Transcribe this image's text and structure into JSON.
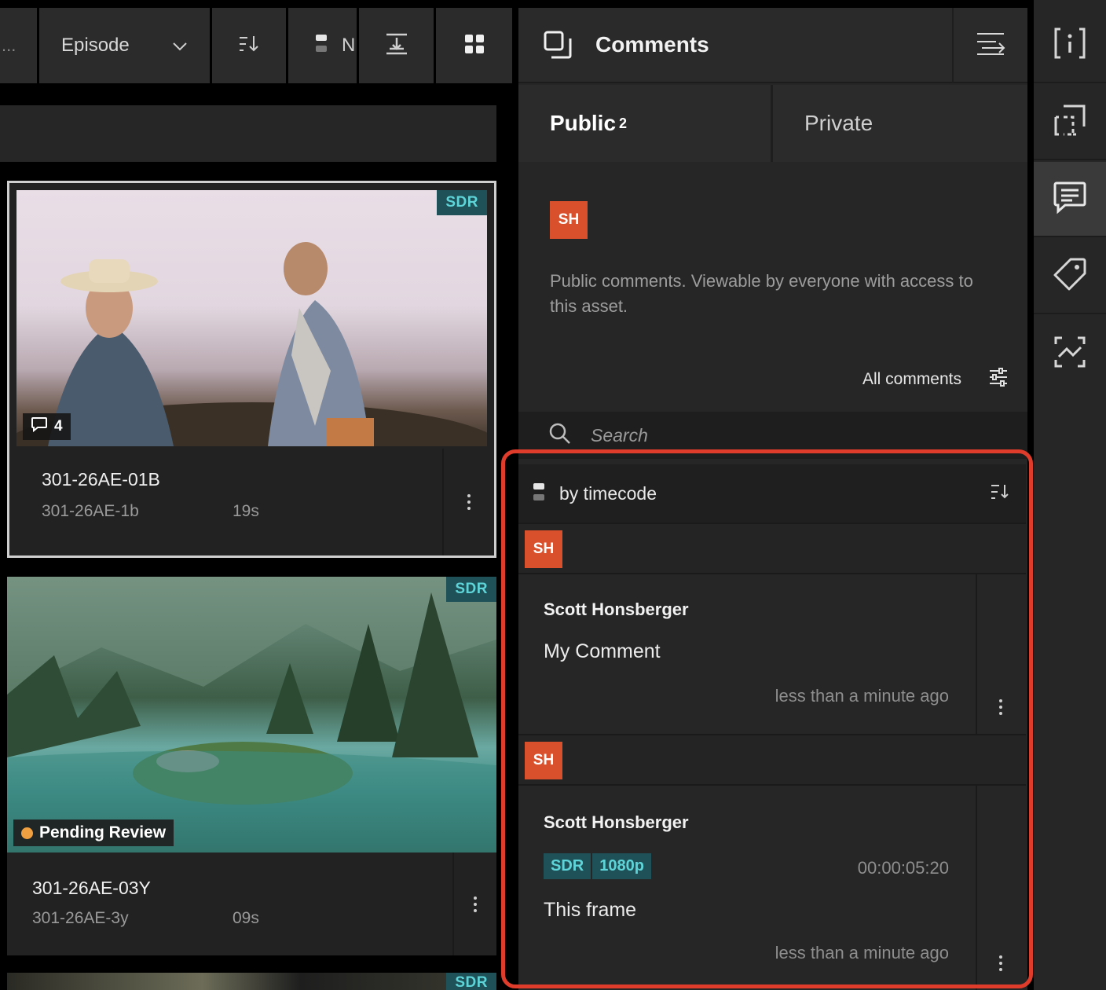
{
  "toolbar": {
    "overflow": "...",
    "group_by_value": "Episode",
    "group_toggle_label": "N"
  },
  "assets": [
    {
      "title": "301-26AE-01B",
      "subtitle": "301-26AE-1b",
      "duration": "19s",
      "badge": "SDR",
      "comment_count": "4",
      "selected": true
    },
    {
      "title": "301-26AE-03Y",
      "subtitle": "301-26AE-3y",
      "duration": "09s",
      "badge": "SDR",
      "status": "Pending Review",
      "status_color": "#f0a040"
    },
    {
      "badge": "SDR"
    }
  ],
  "comments_panel": {
    "title": "Comments",
    "tabs": [
      {
        "label": "Public",
        "count": "2",
        "active": true
      },
      {
        "label": "Private",
        "active": false
      }
    ],
    "compose": {
      "avatar_initials": "SH",
      "placeholder": "Public comments. Viewable by everyone with access to this asset."
    },
    "filter_label": "All comments",
    "search_placeholder": "Search",
    "group_label": "by timecode",
    "threads": [
      {
        "avatar_initials": "SH",
        "author": "Scott Honsberger",
        "body": "My Comment",
        "time": "less than a minute ago"
      },
      {
        "avatar_initials": "SH",
        "author": "Scott Honsberger",
        "tags": [
          "SDR",
          "1080p"
        ],
        "timecode": "00:00:05:20",
        "body": "This frame",
        "time": "less than a minute ago"
      }
    ]
  },
  "colors": {
    "accent_avatar": "#d9512c",
    "badge_bg": "#1f5258",
    "badge_text": "#5fd4d8",
    "highlight": "#e03c2c"
  },
  "rail": [
    "info-icon",
    "frame-icon",
    "comments-icon",
    "tag-icon",
    "analysis-icon"
  ]
}
